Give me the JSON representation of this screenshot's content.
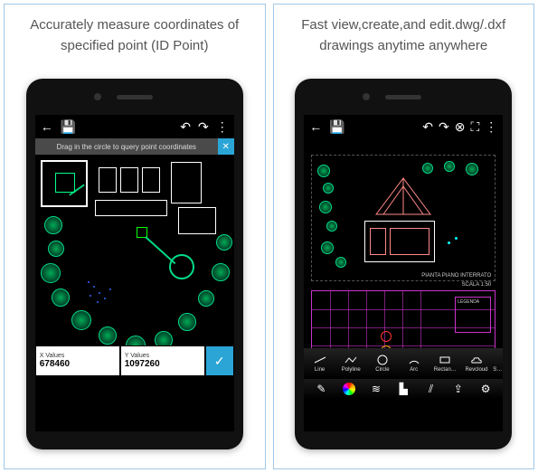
{
  "panel1": {
    "caption": "Accurately measure coordinates of specified point (ID Point)",
    "hint": "Drag in the circle to query point coordinates",
    "xlabel": "X Values",
    "xvalue": "678460",
    "ylabel": "Y Values",
    "yvalue": "1097260"
  },
  "panel2": {
    "caption": "Fast view,create,and edit.dwg/.dxf drawings anytime anywhere",
    "plan_label": "PIANTA PIANO INTERRATO",
    "plan_scale": "SCALA 1:50",
    "legenda": "LEGENDA",
    "tools": {
      "line": "Line",
      "polyline": "Polyline",
      "circle": "Circle",
      "arc": "Arc",
      "rectan": "Rectan…",
      "revcloud": "Revcloud",
      "s": "S…"
    }
  }
}
